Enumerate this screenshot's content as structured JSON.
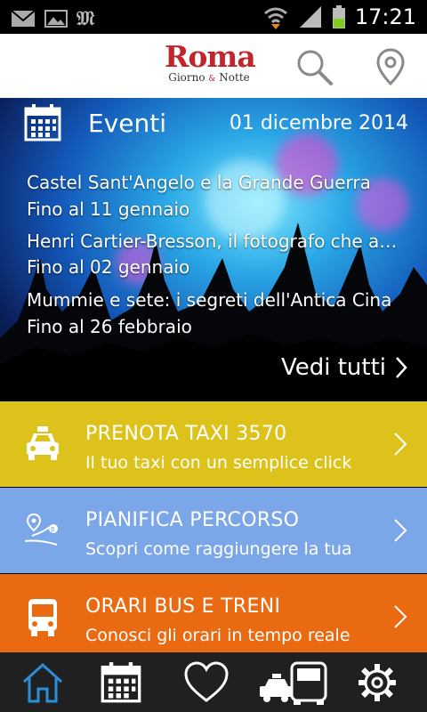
{
  "status_bar": {
    "time": "17:21",
    "icons": [
      "mail-icon",
      "image-icon",
      "newspaper-m-icon",
      "wifi-icon",
      "signal-icon",
      "battery-icon"
    ]
  },
  "header": {
    "logo_main": "Roma",
    "logo_sub_left": "Giorno",
    "logo_sub_amp": "&",
    "logo_sub_right": "Notte",
    "icons": [
      "search-icon",
      "location-pin-icon"
    ]
  },
  "events": {
    "title": "Eventi",
    "date": "01 dicembre 2014",
    "items": [
      {
        "name": "Castel Sant'Angelo e la Grande Guerra",
        "until": "Fino al 11 gennaio"
      },
      {
        "name": "Henri Cartier-Bresson, il fotografo che amo i...",
        "until": "Fino al 02 gennaio"
      },
      {
        "name": "Mummie e sete: i segreti dell'Antica Cina",
        "until": "Fino al 26 febbraio"
      }
    ],
    "see_all": "Vedi tutti"
  },
  "actions": [
    {
      "title": "PRENOTA TAXI 3570",
      "subtitle": "Il tuo taxi con un semplice click",
      "color": "#dcc21a",
      "icon": "taxi-icon"
    },
    {
      "title": "PIANIFICA PERCORSO",
      "subtitle": "Scopri come raggiungere la tua",
      "color": "#7ba7e8",
      "icon": "route-icon"
    },
    {
      "title": "ORARI BUS E TRENI",
      "subtitle": "Conosci gli orari in tempo reale",
      "color": "#ea6a12",
      "icon": "bus-icon"
    }
  ],
  "tab_bar": {
    "tabs": [
      "home-icon",
      "calendar-icon",
      "heart-icon",
      "transport-icon",
      "settings-gear-icon"
    ],
    "active_color": "#2a8fd8"
  }
}
